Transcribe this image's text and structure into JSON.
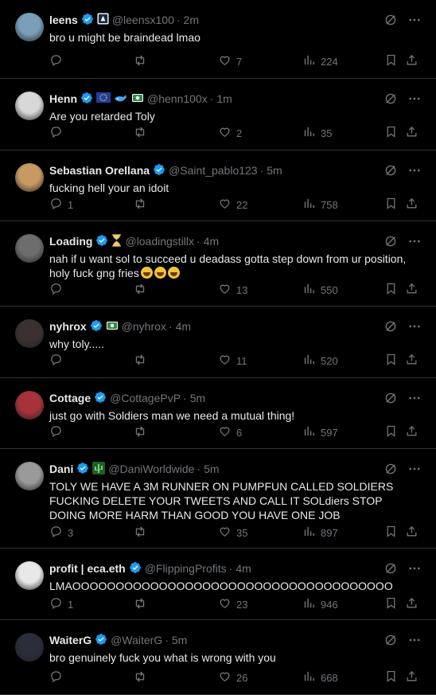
{
  "colors": {
    "background": "#000000",
    "text": "#e7e9ea",
    "muted": "#71767b",
    "verified": "#1d9bf0",
    "divider": "#2f3336"
  },
  "replies": [
    {
      "name": "leens",
      "handle": "@leensx100",
      "time": "2m",
      "text": "bro u might be braindead lmao",
      "replies": "",
      "reposts": "",
      "likes": "7",
      "views": "224",
      "extra_badges": [
        "affiliate-icon"
      ],
      "avatar_color": "#7a9fb8"
    },
    {
      "name": "Henn",
      "handle": "@henn100x",
      "time": "1m",
      "text": "Are you retarded Toly",
      "replies": "",
      "reposts": "",
      "likes": "2",
      "views": "35",
      "extra_badges": [
        "eu-flag-icon",
        "whale-icon",
        "money-icon"
      ],
      "avatar_color": "#d8d8d8"
    },
    {
      "name": "Sebastian Orellana",
      "handle": "@Saint_pablo123",
      "time": "5m",
      "text": "fucking hell your an idoit",
      "replies": "1",
      "reposts": "",
      "likes": "22",
      "views": "758",
      "extra_badges": [],
      "avatar_color": "#c79a63"
    },
    {
      "name": "Loading",
      "handle": "@loadingstillx",
      "time": "4m",
      "text": "nah if u want sol to succeed u deadass gotta step down from ur position, holy fuck gng fries",
      "replies": "",
      "reposts": "",
      "likes": "13",
      "views": "550",
      "extra_badges": [
        "hourglass-icon"
      ],
      "avatar_color": "#6d6d6d",
      "emoji_count": 3
    },
    {
      "name": "nyhrox",
      "handle": "@nyhrox",
      "time": "4m",
      "text": "why toly.....",
      "replies": "",
      "reposts": "",
      "likes": "11",
      "views": "520",
      "extra_badges": [
        "money-icon"
      ],
      "avatar_color": "#3a3030"
    },
    {
      "name": "Cottage",
      "handle": "@CottagePvP",
      "time": "5m",
      "text": "just go with Soldiers man we need a mutual thing!",
      "replies": "",
      "reposts": "",
      "likes": "6",
      "views": "597",
      "extra_badges": [],
      "avatar_color": "#a8323a"
    },
    {
      "name": "Dani",
      "handle": "@DaniWorldwide",
      "time": "5m",
      "text": "TOLY WE HAVE A 3M RUNNER ON PUMPFUN CALLED SOLDIERS FUCKING DELETE YOUR TWEETS AND CALL IT SOLdiers STOP DOING MORE HARM THAN GOOD YOU HAVE ONE JOB",
      "replies": "3",
      "reposts": "",
      "likes": "35",
      "views": "897",
      "extra_badges": [
        "cactus-icon"
      ],
      "avatar_color": "#9a9a9a"
    },
    {
      "name": "profit | eca.eth",
      "handle": "@FlippingProfits",
      "time": "4m",
      "text": "LMAOOOOOOOOOOOOOOOOOOOOOOOOOOOOOOOOOOOOO",
      "replies": "1",
      "reposts": "",
      "likes": "23",
      "views": "946",
      "extra_badges": [],
      "avatar_color": "#e8e8e8"
    },
    {
      "name": "WaiterG",
      "handle": "@WaiterG",
      "time": "5m",
      "text": "bro genuinely fuck you what is wrong with you",
      "replies": "",
      "reposts": "",
      "likes": "26",
      "views": "668",
      "extra_badges": [],
      "avatar_color": "#2a2d3a"
    }
  ]
}
